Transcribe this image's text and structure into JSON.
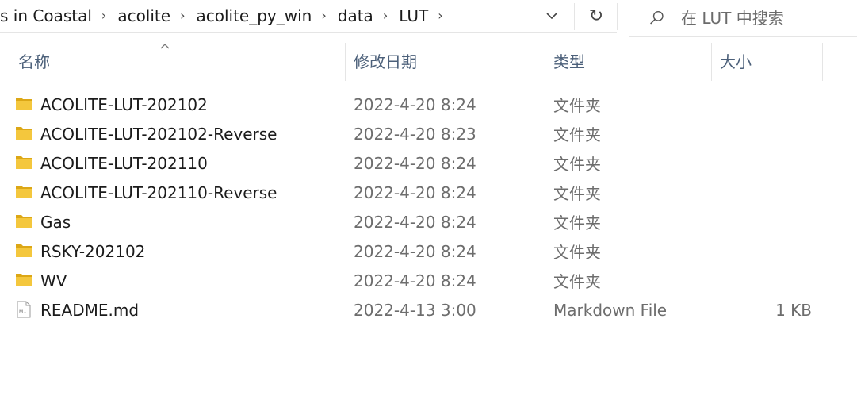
{
  "breadcrumbs": [
    {
      "label": "s in Coastal"
    },
    {
      "label": "acolite"
    },
    {
      "label": "acolite_py_win"
    },
    {
      "label": "data"
    },
    {
      "label": "LUT"
    }
  ],
  "search": {
    "placeholder": "在 LUT 中搜索",
    "value": ""
  },
  "columns": {
    "name": "名称",
    "date": "修改日期",
    "type": "类型",
    "size": "大小"
  },
  "files": [
    {
      "name": "ACOLITE-LUT-202102",
      "date": "2022-4-20 8:24",
      "type": "文件夹",
      "size": "",
      "icon": "folder-icon"
    },
    {
      "name": "ACOLITE-LUT-202102-Reverse",
      "date": "2022-4-20 8:23",
      "type": "文件夹",
      "size": "",
      "icon": "folder-icon"
    },
    {
      "name": "ACOLITE-LUT-202110",
      "date": "2022-4-20 8:24",
      "type": "文件夹",
      "size": "",
      "icon": "folder-icon"
    },
    {
      "name": "ACOLITE-LUT-202110-Reverse",
      "date": "2022-4-20 8:24",
      "type": "文件夹",
      "size": "",
      "icon": "folder-icon"
    },
    {
      "name": "Gas",
      "date": "2022-4-20 8:24",
      "type": "文件夹",
      "size": "",
      "icon": "folder-icon"
    },
    {
      "name": "RSKY-202102",
      "date": "2022-4-20 8:24",
      "type": "文件夹",
      "size": "",
      "icon": "folder-icon"
    },
    {
      "name": "WV",
      "date": "2022-4-20 8:24",
      "type": "文件夹",
      "size": "",
      "icon": "folder-icon"
    },
    {
      "name": "README.md",
      "date": "2022-4-13 3:00",
      "type": "Markdown File",
      "size": "1 KB",
      "icon": "markdown-file-icon"
    }
  ],
  "colors": {
    "folder": "#f4c73d",
    "folder_dark": "#dca716",
    "header_text": "#4c607a",
    "meta_text": "#6d6d6d"
  }
}
